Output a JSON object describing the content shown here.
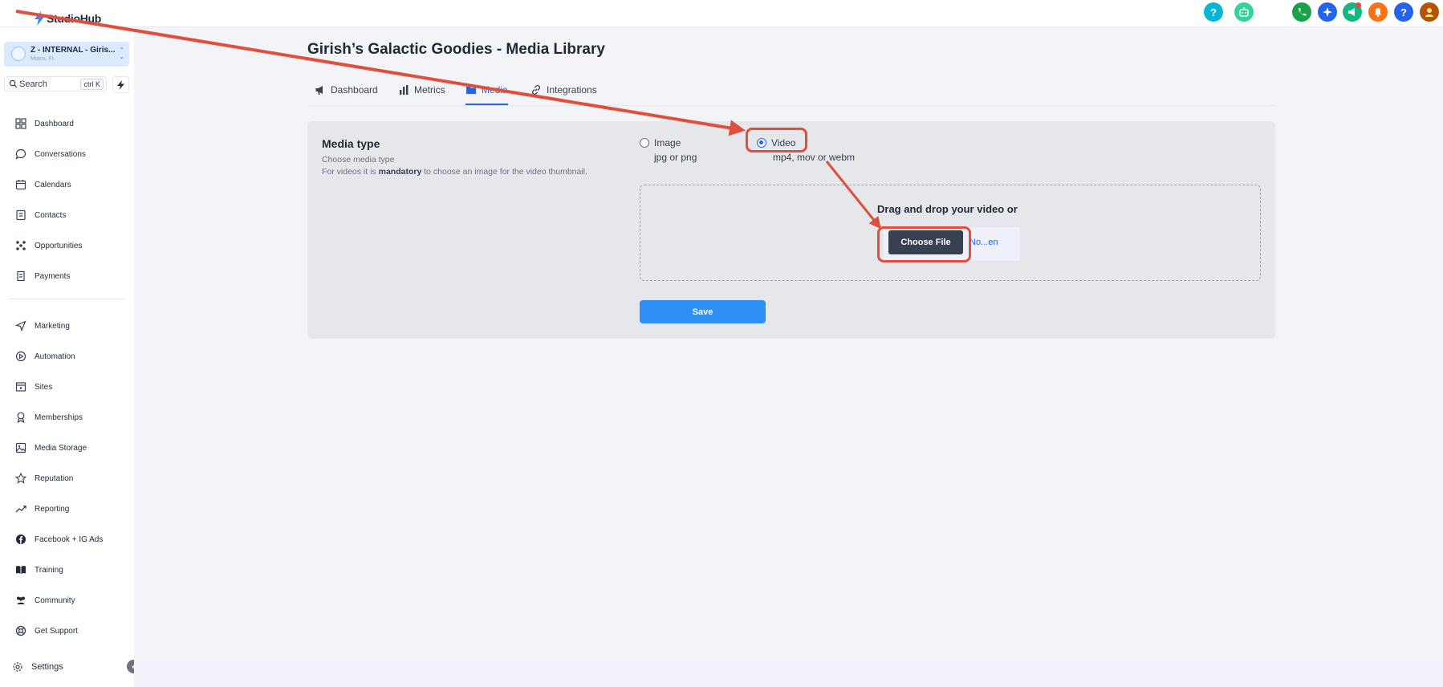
{
  "app": {
    "logo_text": "StudioHub",
    "page_title": "Girish’s Galactic Goodies - Media Library"
  },
  "topbar": {
    "icons": [
      {
        "name": "help-icon",
        "glyph": "?",
        "color": "#06b6d4"
      },
      {
        "name": "assistant-icon",
        "glyph": "",
        "color": "#34d399"
      },
      {
        "name": "phone-icon",
        "glyph": "",
        "color": "#16a34a"
      },
      {
        "name": "sparkle-icon",
        "glyph": "",
        "color": "#2563eb"
      },
      {
        "name": "megaphone-icon",
        "glyph": "",
        "color": "#10b981"
      },
      {
        "name": "bell-icon",
        "glyph": "",
        "color": "#f97316"
      },
      {
        "name": "question-icon",
        "glyph": "?",
        "color": "#2563eb"
      },
      {
        "name": "user-avatar-icon",
        "glyph": "",
        "color": "#b45309"
      }
    ]
  },
  "sidebar": {
    "account": {
      "name": "Z - INTERNAL - Giris...",
      "location": "Miami, FL"
    },
    "search": {
      "placeholder": "Search",
      "shortcut": "ctrl K"
    },
    "items": [
      {
        "label": "Dashboard",
        "icon": "dashboard-icon"
      },
      {
        "label": "Conversations",
        "icon": "chat-icon"
      },
      {
        "label": "Calendars",
        "icon": "calendar-icon"
      },
      {
        "label": "Contacts",
        "icon": "contacts-icon"
      },
      {
        "label": "Opportunities",
        "icon": "opportunities-icon"
      },
      {
        "label": "Payments",
        "icon": "payments-icon"
      },
      {
        "label": "Marketing",
        "icon": "send-icon"
      },
      {
        "label": "Automation",
        "icon": "automation-icon"
      },
      {
        "label": "Sites",
        "icon": "sites-icon"
      },
      {
        "label": "Memberships",
        "icon": "award-icon"
      },
      {
        "label": "Media Storage",
        "icon": "image-icon"
      },
      {
        "label": "Reputation",
        "icon": "star-icon"
      },
      {
        "label": "Reporting",
        "icon": "trend-icon"
      },
      {
        "label": "Facebook + IG Ads",
        "icon": "facebook-icon"
      },
      {
        "label": "Training",
        "icon": "book-icon"
      },
      {
        "label": "Community",
        "icon": "users-icon"
      },
      {
        "label": "Get Support",
        "icon": "lifebuoy-icon"
      }
    ],
    "settings_label": "Settings"
  },
  "tabs": [
    {
      "label": "Dashboard",
      "icon": "megaphone-icon",
      "active": false
    },
    {
      "label": "Metrics",
      "icon": "bar-chart-icon",
      "active": false
    },
    {
      "label": "Media",
      "icon": "folder-icon",
      "active": true
    },
    {
      "label": "Integrations",
      "icon": "link-icon",
      "active": false
    }
  ],
  "media_form": {
    "title": "Media type",
    "subtitle": "Choose media type",
    "note_prefix": "For videos it is ",
    "note_bold": "mandatory",
    "note_suffix": " to choose an image for the video thumbnail.",
    "options": [
      {
        "label": "Image",
        "hint": "jpg or png",
        "checked": false
      },
      {
        "label": "Video",
        "hint": "mp4, mov or webm",
        "checked": true
      }
    ],
    "dropzone_text": "Drag and drop your video or",
    "choose_file_label": "Choose File",
    "file_name": "No...en",
    "save_label": "Save"
  },
  "colors": {
    "accent": "#2563eb",
    "save_button": "#2e8ff4",
    "annotation": "#e04f3c"
  }
}
